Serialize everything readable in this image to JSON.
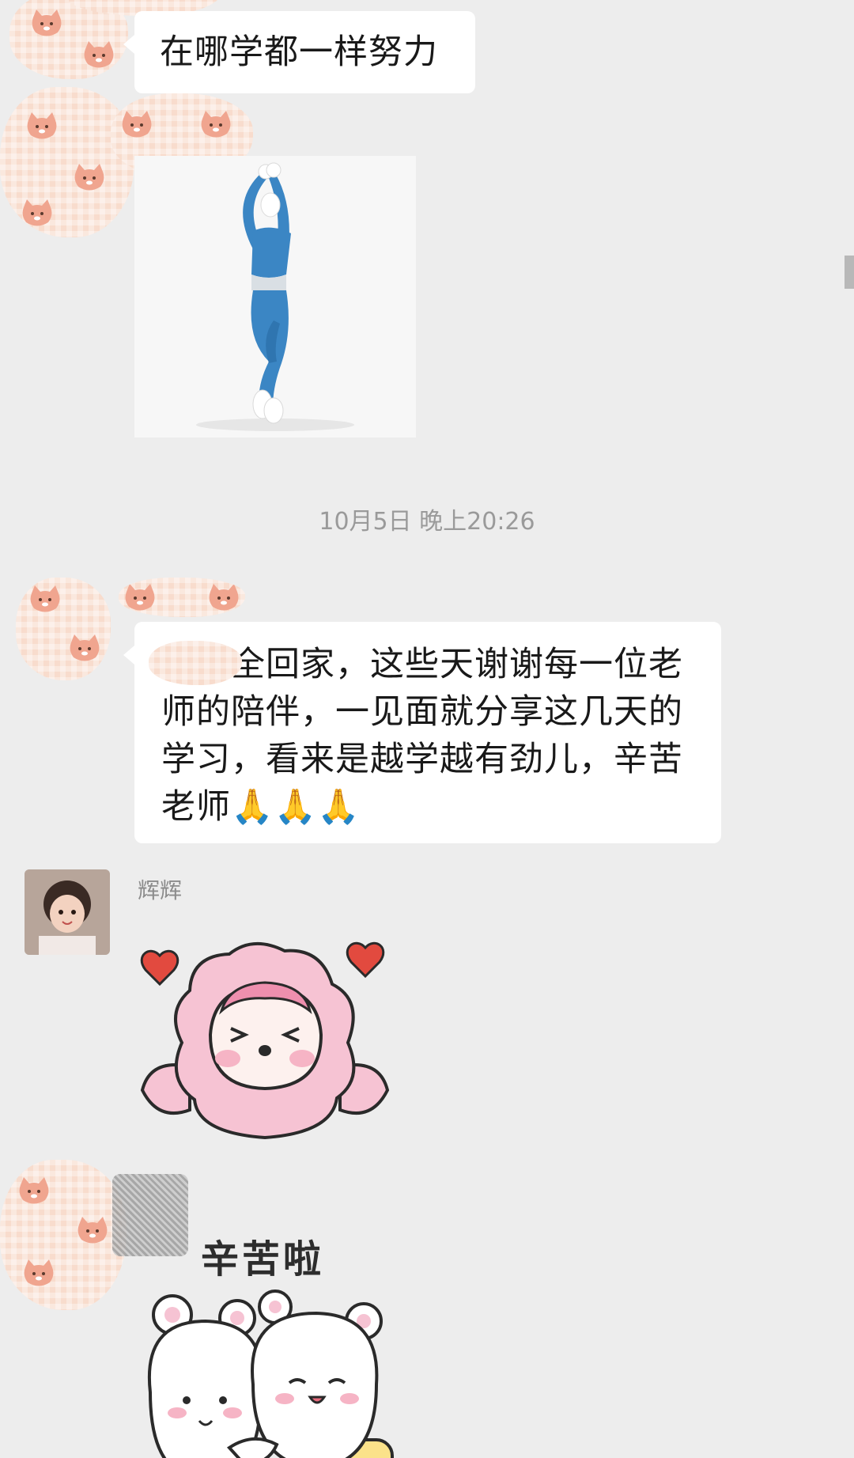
{
  "messages": [
    {
      "type": "text",
      "text": "在哪学都一样努力"
    },
    {
      "type": "image",
      "icon": "dancing-figure-image"
    },
    {
      "type": "timestamp",
      "text": "10月5日 晚上20:26"
    },
    {
      "type": "text",
      "text": "已安全回家，这些天谢谢每一位老师的陪伴，一见面就分享这几天的学习，看来是越学越有劲儿，辛苦老师🙏🙏🙏"
    },
    {
      "type": "sticker",
      "sender": "辉辉",
      "icon": "pink-sheep-sticker"
    },
    {
      "type": "sticker",
      "caption": "辛苦啦",
      "icon": "hugging-bears-sticker"
    }
  ],
  "colors": {
    "chat_background": "#ededed",
    "bubble": "#ffffff",
    "timestamp_text": "#9a9a9a",
    "censor_pink": "#f8dccd"
  }
}
